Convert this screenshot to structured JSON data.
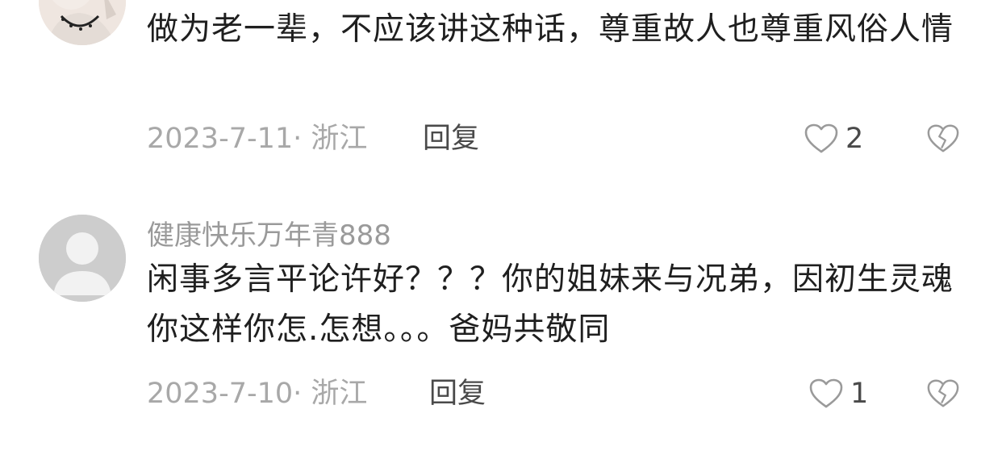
{
  "comments": [
    {
      "username": "",
      "text": "做为老一辈，不应该讲这种话，尊重故人也尊重风俗人情",
      "meta": "2023-7-11· 浙江",
      "reply_label": "回复",
      "like_count": "2"
    },
    {
      "username": "健康快乐万年青888",
      "text": "闲事多言平论许好？？？你的姐妹来与况弟，因初生灵魂你这样你怎.怎想。。。爸妈共敬同",
      "meta": "2023-7-10· 浙江",
      "reply_label": "回复",
      "like_count": "1"
    }
  ],
  "icons": {
    "like": "heart-outline-icon",
    "dislike": "broken-heart-icon"
  },
  "colors": {
    "text": "#1f1f1f",
    "meta": "#a8a8a8",
    "icon": "#9a9a9a"
  }
}
